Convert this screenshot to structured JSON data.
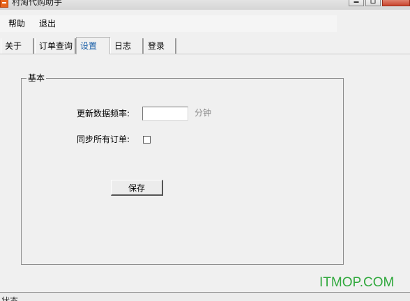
{
  "window": {
    "title": "村淘代购助手"
  },
  "menu": {
    "items": [
      "帮助",
      "退出"
    ]
  },
  "tabs": [
    {
      "label": "关于"
    },
    {
      "label": "订单查询"
    },
    {
      "label": "设置",
      "active": true
    },
    {
      "label": "日志"
    },
    {
      "label": "登录"
    }
  ],
  "settings": {
    "group_title": "基本",
    "refresh_label": "更新数据频率:",
    "refresh_value": "",
    "refresh_unit": "分钟",
    "sync_label": "同步所有订单:",
    "sync_checked": false,
    "save_label": "保存"
  },
  "statusbar": {
    "text": "状态"
  },
  "watermark": {
    "text": "ITMOP.COM"
  },
  "colors": {
    "active_tab_text": "#1a5fa8",
    "watermark": "#2fa83c",
    "close_button": "#c9452e"
  }
}
